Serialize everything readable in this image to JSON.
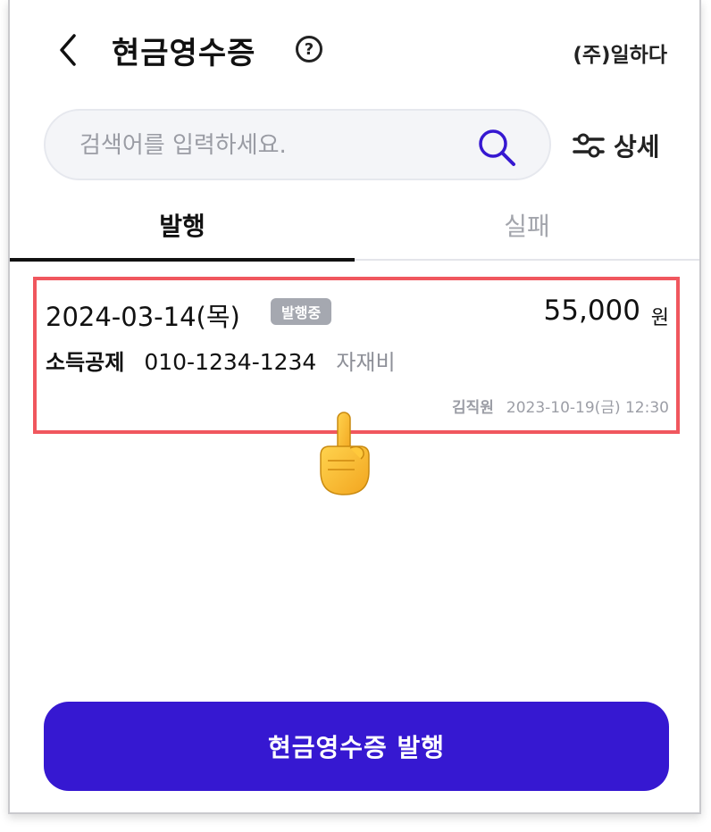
{
  "header": {
    "title": "현금영수증",
    "help_label": "?",
    "company": "(주)일하다"
  },
  "search": {
    "placeholder": "검색어를 입력하세요.",
    "value": ""
  },
  "filter": {
    "label": "상세"
  },
  "tabs": [
    {
      "label": "발행",
      "active": true
    },
    {
      "label": "실패",
      "active": false
    }
  ],
  "receipts": [
    {
      "date": "2024-03-14(목)",
      "status": "발행중",
      "amount": "55,000",
      "unit": "원",
      "type": "소득공제",
      "phone": "010-1234-1234",
      "category": "자재비",
      "staff": "김직원",
      "created": "2023-10-19(금) 12:30"
    }
  ],
  "issue_button": {
    "label": "현금영수증 발행"
  },
  "colors": {
    "accent": "#3618d1",
    "highlight": "#f0575e",
    "badge": "#a5a8b0"
  }
}
